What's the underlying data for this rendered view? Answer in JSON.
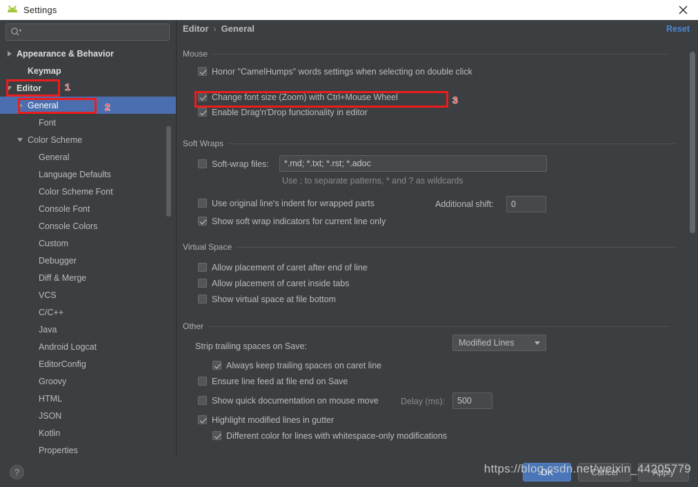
{
  "window": {
    "title": "Settings",
    "app_icon": "android-icon",
    "close_icon": "close-icon"
  },
  "sidebar": {
    "search": {
      "value": "",
      "placeholder": "",
      "icon": "search-icon"
    },
    "items": [
      {
        "label": "Appearance & Behavior",
        "indent": 0,
        "arrow": "collapsed",
        "bold": true,
        "selected": false
      },
      {
        "label": "Keymap",
        "indent": 1,
        "arrow": "none",
        "bold": true,
        "selected": false
      },
      {
        "label": "Editor",
        "indent": 0,
        "arrow": "expanded",
        "bold": true,
        "selected": false
      },
      {
        "label": "General",
        "indent": 1,
        "arrow": "collapsed",
        "bold": false,
        "selected": true
      },
      {
        "label": "Font",
        "indent": 2,
        "arrow": "none",
        "bold": false,
        "selected": false
      },
      {
        "label": "Color Scheme",
        "indent": 1,
        "arrow": "expanded",
        "bold": false,
        "selected": false
      },
      {
        "label": "General",
        "indent": 2,
        "arrow": "none",
        "bold": false,
        "selected": false
      },
      {
        "label": "Language Defaults",
        "indent": 2,
        "arrow": "none",
        "bold": false,
        "selected": false
      },
      {
        "label": "Color Scheme Font",
        "indent": 2,
        "arrow": "none",
        "bold": false,
        "selected": false
      },
      {
        "label": "Console Font",
        "indent": 2,
        "arrow": "none",
        "bold": false,
        "selected": false
      },
      {
        "label": "Console Colors",
        "indent": 2,
        "arrow": "none",
        "bold": false,
        "selected": false
      },
      {
        "label": "Custom",
        "indent": 2,
        "arrow": "none",
        "bold": false,
        "selected": false
      },
      {
        "label": "Debugger",
        "indent": 2,
        "arrow": "none",
        "bold": false,
        "selected": false
      },
      {
        "label": "Diff & Merge",
        "indent": 2,
        "arrow": "none",
        "bold": false,
        "selected": false
      },
      {
        "label": "VCS",
        "indent": 2,
        "arrow": "none",
        "bold": false,
        "selected": false
      },
      {
        "label": "C/C++",
        "indent": 2,
        "arrow": "none",
        "bold": false,
        "selected": false
      },
      {
        "label": "Java",
        "indent": 2,
        "arrow": "none",
        "bold": false,
        "selected": false
      },
      {
        "label": "Android Logcat",
        "indent": 2,
        "arrow": "none",
        "bold": false,
        "selected": false
      },
      {
        "label": "EditorConfig",
        "indent": 2,
        "arrow": "none",
        "bold": false,
        "selected": false
      },
      {
        "label": "Groovy",
        "indent": 2,
        "arrow": "none",
        "bold": false,
        "selected": false
      },
      {
        "label": "HTML",
        "indent": 2,
        "arrow": "none",
        "bold": false,
        "selected": false
      },
      {
        "label": "JSON",
        "indent": 2,
        "arrow": "none",
        "bold": false,
        "selected": false
      },
      {
        "label": "Kotlin",
        "indent": 2,
        "arrow": "none",
        "bold": false,
        "selected": false
      },
      {
        "label": "Properties",
        "indent": 2,
        "arrow": "none",
        "bold": false,
        "selected": false
      }
    ]
  },
  "breadcrumb": {
    "parent": "Editor",
    "separator": "›",
    "current": "General"
  },
  "reset": {
    "label": "Reset"
  },
  "groups": {
    "mouse": {
      "title": "Mouse",
      "options": [
        {
          "label": "Honor \"CamelHumps\" words settings when selecting on double click",
          "checked": true
        },
        {
          "label": "Change font size (Zoom) with Ctrl+Mouse Wheel",
          "checked": true
        },
        {
          "label": "Enable Drag'n'Drop functionality in editor",
          "checked": true
        }
      ]
    },
    "soft_wraps": {
      "title": "Soft Wraps",
      "softwrap_files": {
        "label": "Soft-wrap files:",
        "checked": false,
        "value": "*.md; *.txt; *.rst; *.adoc"
      },
      "hint": "Use ; to separate patterns, * and ? as wildcards",
      "use_original_indent": {
        "label": "Use original line's indent for wrapped parts",
        "checked": false
      },
      "additional_shift": {
        "label": "Additional shift:",
        "value": "0"
      },
      "show_indicators": {
        "label": "Show soft wrap indicators for current line only",
        "checked": true
      }
    },
    "virtual_space": {
      "title": "Virtual Space",
      "options": [
        {
          "label": "Allow placement of caret after end of line",
          "checked": false
        },
        {
          "label": "Allow placement of caret inside tabs",
          "checked": false
        },
        {
          "label": "Show virtual space at file bottom",
          "checked": false
        }
      ]
    },
    "other": {
      "title": "Other",
      "strip_trailing": {
        "label": "Strip trailing spaces on Save:",
        "value": "Modified Lines"
      },
      "always_keep": {
        "label": "Always keep trailing spaces on caret line",
        "checked": true
      },
      "ensure_linefeed": {
        "label": "Ensure line feed at file end on Save",
        "checked": false
      },
      "quick_doc": {
        "label": "Show quick documentation on mouse move",
        "checked": false
      },
      "delay": {
        "label": "Delay (ms):",
        "value": "500"
      },
      "highlight_modified": {
        "label": "Highlight modified lines in gutter",
        "checked": true
      },
      "different_color": {
        "label": "Different color for lines with whitespace-only modifications",
        "checked": true
      }
    }
  },
  "footer": {
    "help_label": "?",
    "ok_label": "OK",
    "cancel_label": "Cancel",
    "apply_label": "Apply"
  },
  "watermark": {
    "text": "https://blog.csdn.net/weixin_44205779"
  },
  "annotations": [
    {
      "num": "1"
    },
    {
      "num": "2"
    },
    {
      "num": "3"
    }
  ],
  "colors": {
    "accent_blue": "#4b6eaf",
    "link_blue": "#4e86d6",
    "annotation_red": "#ee1c1c",
    "background": "#3c3f41",
    "android_green": "#a4c639"
  }
}
